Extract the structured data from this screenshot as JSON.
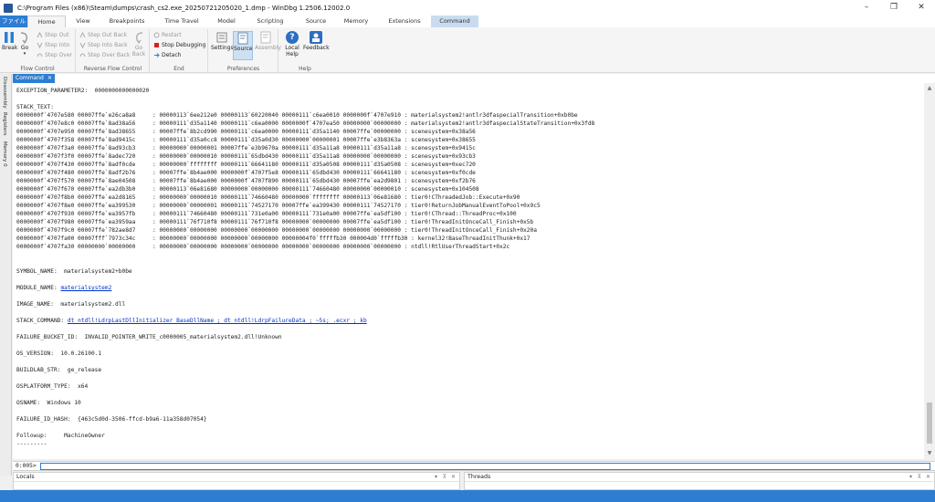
{
  "window": {
    "title": "C:\\Program Files (x86)\\Steam\\dumps\\crash_cs2.exe_20250721205020_1.dmp - WinDbg 1.2506.12002.0",
    "controls": {
      "minimize": "–",
      "maximize": "❐",
      "close": "✕"
    }
  },
  "tabs": [
    {
      "label": "ファイル"
    },
    {
      "label": "Home"
    },
    {
      "label": "View"
    },
    {
      "label": "Breakpoints"
    },
    {
      "label": "Time Travel"
    },
    {
      "label": "Model"
    },
    {
      "label": "Scripting"
    },
    {
      "label": "Source"
    },
    {
      "label": "Memory"
    },
    {
      "label": "Extensions"
    },
    {
      "label": "Command"
    }
  ],
  "ribbon": {
    "flow_control": {
      "label": "Flow Control",
      "break": "Break",
      "go": "Go",
      "step_out": "Step Out",
      "step_into": "Step Into",
      "step_over": "Step Over"
    },
    "reverse_flow_control": {
      "label": "Reverse Flow Control",
      "step_out_back": "Step Out Back",
      "step_into_back": "Step Into Back",
      "step_over_back": "Step Over Back",
      "go_back": "Go Back"
    },
    "end": {
      "label": "End",
      "restart": "Restart",
      "stop_debugging": "Stop Debugging",
      "detach": "Detach"
    },
    "preferences": {
      "label": "Preferences",
      "settings": "Settings",
      "source": "Source",
      "assembly": "Assembly"
    },
    "help": {
      "label": "Help",
      "local_help": "Local Help",
      "feedback": "Feedback"
    }
  },
  "sidebar": {
    "items": [
      "Disassembly",
      "Registers",
      "Memory 0"
    ]
  },
  "command_pane": {
    "tab_label": "Command",
    "lines": [
      "EXCEPTION_PARAMETER2:  0000000000000020",
      "",
      "STACK_TEXT:",
      "0000000f`4707e580 00007ffe`e26ca8a8     : 00000113`6ee212e0 00000113`60220040 00000111`c6ea0010 0000000f`4707e910 : materialsystem2!antlr3dfaspecialTransition+0xb0be",
      "0000000f`4707e8c0 00007ffe`8ad38a56     : 00000111`d35a1140 00000111`c6ea0000 0000000f`4707ea50 00000000`00000000 : materialsystem2!antlr3dfaspecialStateTransition+0x3fd8",
      "0000000f`4707e950 00007ffe`8ad38655     : 00007ffe`8b2cd990 00000111`c6ea0000 00000111`d35a1140 00007ffe`00000000 : scenesystem+0x38a56",
      "0000000f`4707f358 00007ffe`8ad9415c     : 00000111`d35a0cc8 00000111`d35a0d30 00000000`00000001 00007ffe`e3b8363a : scenesystem+0x38655",
      "0000000f`4707f3a0 00007ffe`8ad93cb3     : 00000000`00000001 00007ffe`e3b9670a 00000111`d35a11a8 00000111`d35a11a8 : scenesystem+0x9415c",
      "0000000f`4707f3f0 00007ffe`8adec720     : 00000000`00000010 00000111`65dbd430 00000111`d35a11a8 00000000`00000000 : scenesystem+0x93cb3",
      "0000000f`4707f430 00007ffe`8adf0cde     : 00000000`ffffffff 00000111`66641180 00000111`d35a0508 00000111`d35a0508 : scenesystem+0xec720",
      "0000000f`4707f480 00007ffe`8adf2b76     : 00007ffe`8b4ae000 0000000f`4707f5e8 00000111`65dbd430 00000111`66641180 : scenesystem+0xf0cde",
      "0000000f`4707f570 00007ffe`8ae04508     : 00007ffe`8b4ae000 0000000f`4707f890 00000111`65dbd430 00007ffe`ea2d9801 : scenesystem+0xf2b76",
      "0000000f`4707f670 00007ffe`ea2db3b0     : 00000113`06e81680 00000000`00000000 00000111`74660480 00000000`00000010 : scenesystem+0x104508",
      "0000000f`4707f8b0 00007ffe`ea2d8165     : 00000000`00000010 00000111`74660480 00000000`ffffffff 00000113`06e81680 : tier0!CThreadedJob::Execute+0x90",
      "0000000f`4707f8e0 00007ffe`ea399530     : 00000000`00000001 00000111`74527170 00007ffe`ea399430 00000111`74527170 : tier0!ReturnJobManualEventToPool+0x9c5",
      "0000000f`4707f930 00007ffe`ea3957fb     : 00000111`74660480 00000111`731e0a00 00000111`731e0a00 00007ffe`ea5df100 : tier0!CThread::ThreadProc+0x100",
      "0000000f`4707f980 00007ffe`ea3959aa     : 00000111`76f710f8 00000111`76f710f8 00000000`00000000 00007ffe`ea5df100 : tier0!ThreadInitOnceCall_Finish+0x5b",
      "0000000f`4707f9c0 00007ffe`782ae8d7     : 00000000`00000000 00000000`00000000 00000000`00000000 00000000`00000000 : tier0!ThreadInitOnceCall_Finish+0x20a",
      "0000000f`4707fa00 00007fff`7973c34c     : 00000000`00000000 00000000`00000000 00000004f0`fffffb30 000004d0`fffffb30 : kernel32!BaseThreadInitThunk+0x17",
      "0000000f`4707fa30 00000000`00000000     : 00000000`00000000 00000000`00000000 00000000`00000000 00000000`00000000 : ntdll!RtlUserThreadStart+0x2c",
      "",
      "",
      "SYMBOL_NAME:  materialsystem2+b0be",
      "",
      "MODULE_NAME: ",
      "",
      "IMAGE_NAME:  materialsystem2.dll",
      "",
      "STACK_COMMAND: ",
      "",
      "FAILURE_BUCKET_ID:  INVALID_POINTER_WRITE_c0000005_materialsystem2.dll!Unknown",
      "",
      "OS_VERSION:  10.0.26100.1",
      "",
      "BUILDLAB_STR:  ge_release",
      "",
      "OSPLATFORM_TYPE:  x64",
      "",
      "OSNAME:  Windows 10",
      "",
      "FAILURE_ID_HASH:  {463c5d0d-3506-ffcd-b9a6-11a358d07054}",
      "",
      "Followup:     MachineOwner",
      "---------"
    ],
    "module_link": "materialsystem2",
    "stack_command_link": "dt ntdll!LdrpLastDllInitializer BaseDllName ; dt ntdll!LdrpFailureData ; ~5s; .ecxr ; kb"
  },
  "command_input": {
    "prompt": "0:005>",
    "value": ""
  },
  "bottom_panels": {
    "locals": {
      "title": "Locals"
    },
    "threads": {
      "title": "Threads"
    }
  },
  "colors": {
    "accent": "#2d7dd2",
    "link": "#0033cc"
  }
}
